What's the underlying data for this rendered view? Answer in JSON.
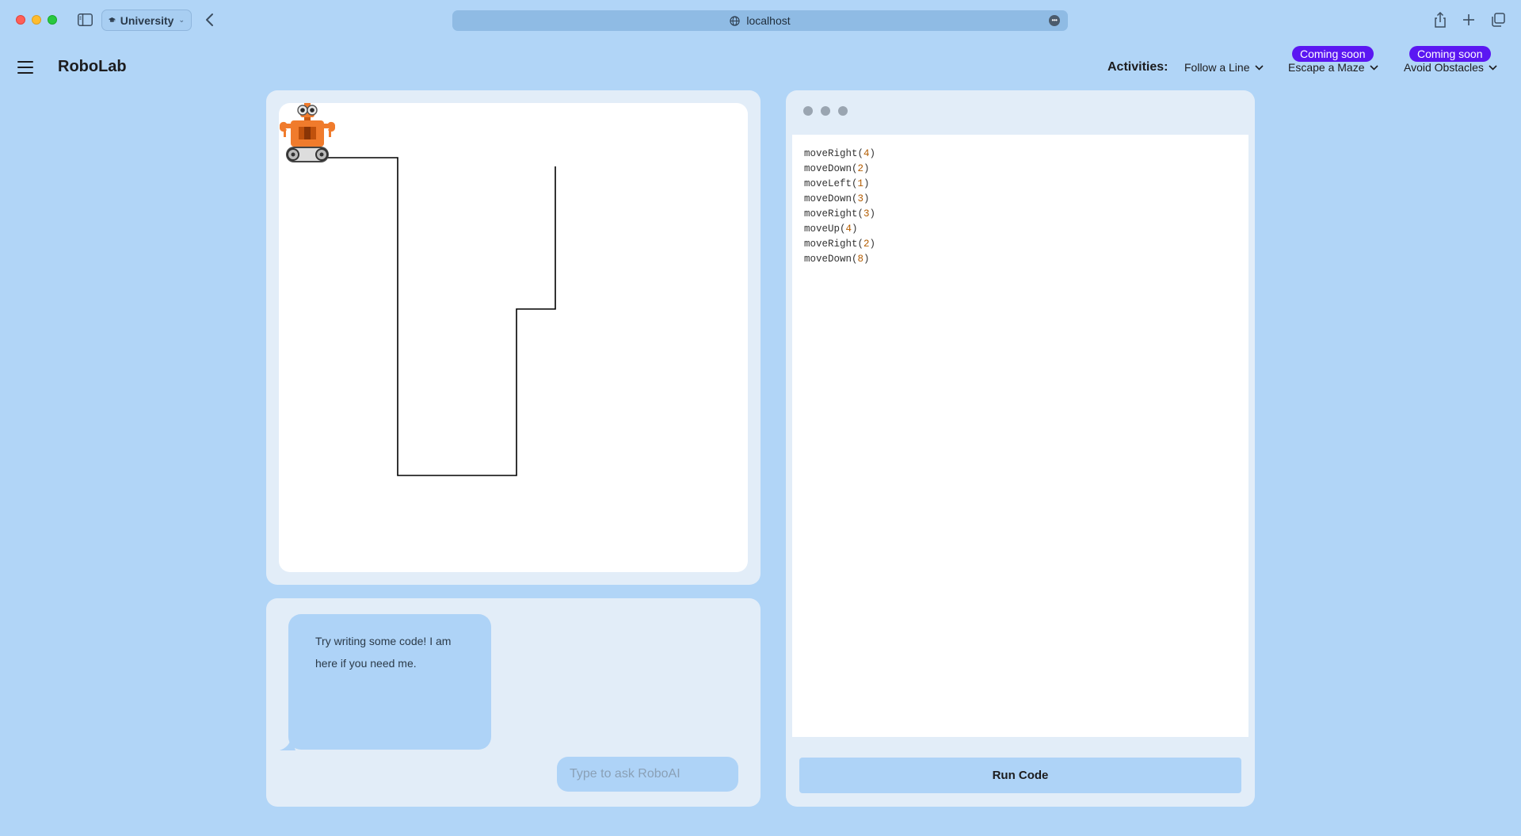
{
  "browser": {
    "profile_label": "University",
    "url": "localhost"
  },
  "app": {
    "brand": "RoboLab",
    "activities_label": "Activities:",
    "activities": [
      {
        "label": "Follow a Line",
        "badge": ""
      },
      {
        "label": "Escape a Maze",
        "badge": "Coming soon"
      },
      {
        "label": "Avoid Obstacles",
        "badge": "Coming soon"
      }
    ]
  },
  "chat": {
    "message": "Try writing some code! I am here if you need me.",
    "input_placeholder": "Type to ask RoboAI"
  },
  "code": {
    "lines": [
      {
        "fn": "moveRight",
        "arg": "4"
      },
      {
        "fn": "moveDown",
        "arg": "2"
      },
      {
        "fn": "moveLeft",
        "arg": "1"
      },
      {
        "fn": "moveDown",
        "arg": "3"
      },
      {
        "fn": "moveRight",
        "arg": "3"
      },
      {
        "fn": "moveUp",
        "arg": "4"
      },
      {
        "fn": "moveRight",
        "arg": "2"
      },
      {
        "fn": "moveDown",
        "arg": "8"
      }
    ],
    "run_label": "Run Code"
  },
  "colors": {
    "background": "#b1d5f7",
    "badge": "#5b17f2",
    "robot_body": "#f07b2c"
  }
}
